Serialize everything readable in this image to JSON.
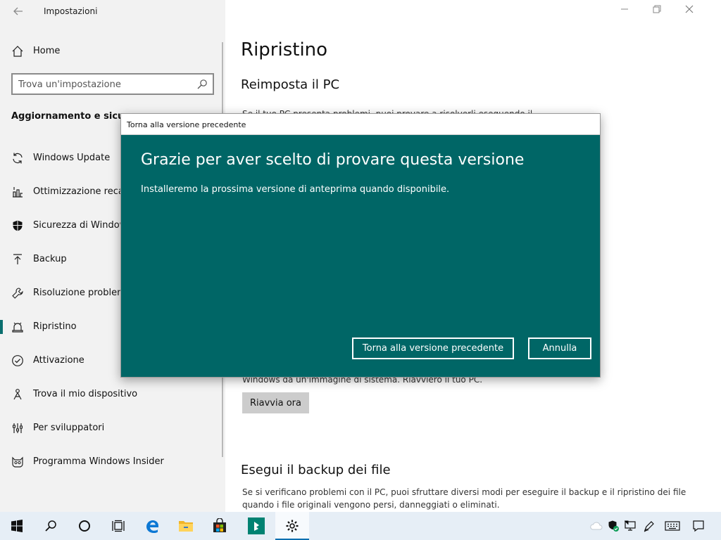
{
  "app": {
    "title": "Impostazioni"
  },
  "sidebar": {
    "home_label": "Home",
    "search_placeholder": "Trova un'impostazione",
    "section_title": "Aggiornamento e sicurezza",
    "items": [
      {
        "label": "Windows Update",
        "icon": "sync-icon"
      },
      {
        "label": "Ottimizzazione recapito",
        "icon": "delivery-icon"
      },
      {
        "label": "Sicurezza di Windows",
        "icon": "shield-icon"
      },
      {
        "label": "Backup",
        "icon": "backup-arrow-icon"
      },
      {
        "label": "Risoluzione problemi",
        "icon": "wrench-icon"
      },
      {
        "label": "Ripristino",
        "icon": "recovery-icon",
        "selected": true
      },
      {
        "label": "Attivazione",
        "icon": "check-circle-icon"
      },
      {
        "label": "Trova il mio dispositivo",
        "icon": "find-device-icon"
      },
      {
        "label": "Per sviluppatori",
        "icon": "developer-icon"
      },
      {
        "label": "Programma Windows Insider",
        "icon": "insider-cat-icon"
      }
    ]
  },
  "main": {
    "title": "Ripristino",
    "reset": {
      "heading": "Reimposta il PC",
      "text": "Se il tuo PC presenta problemi, puoi provare a risolverli eseguendo il"
    },
    "advanced": {
      "text": "Windows da un'immagine di sistema. Riavvierò il tuo PC.",
      "button": "Riavvia ora"
    },
    "backup": {
      "heading": "Esegui il backup dei file",
      "text_line1": "Se si verificano problemi con il PC, puoi sfruttare diversi modi per eseguire il backup e il ripristino dei file",
      "text_line2": "quando i file originali vengono persi, danneggiati o eliminati."
    }
  },
  "dialog": {
    "title": "Torna alla versione precedente",
    "heading": "Grazie per aver scelto di provare questa versione",
    "body": "Installeremo la prossima versione di anteprima quando disponibile.",
    "primary_button": "Torna alla versione precedente",
    "cancel_button": "Annulla"
  },
  "colors": {
    "accent": "#006666",
    "selection_bar": "#0a6e6e",
    "taskbar": "#e6eef6"
  },
  "taskbar": {
    "buttons": [
      "start-icon",
      "search-icon",
      "cortana-icon",
      "task-view-icon",
      "edge-icon",
      "file-explorer-icon",
      "store-icon",
      "teal-app-icon",
      "settings-icon"
    ],
    "tray": [
      "onedrive-icon",
      "security-icon",
      "network-icon",
      "pen-icon",
      "keyboard-icon",
      "notifications-icon"
    ]
  }
}
